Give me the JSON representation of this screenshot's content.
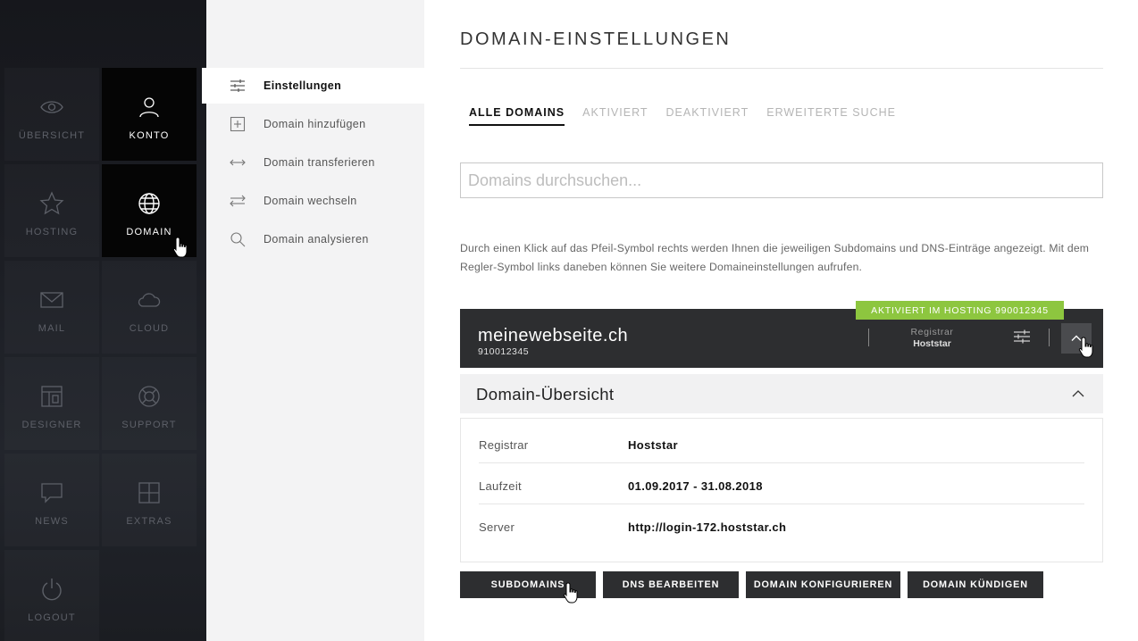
{
  "sidebar": {
    "tiles": [
      {
        "key": "uebersicht",
        "label": "ÜBERSICHT",
        "icon": "eye-icon",
        "active": false
      },
      {
        "key": "konto",
        "label": "KONTO",
        "icon": "user-icon",
        "active": true
      },
      {
        "key": "hosting",
        "label": "HOSTING",
        "icon": "star-icon",
        "active": false
      },
      {
        "key": "domain",
        "label": "DOMAIN",
        "icon": "globe-icon",
        "active": true
      },
      {
        "key": "mail",
        "label": "MAIL",
        "icon": "envelope-icon",
        "active": false
      },
      {
        "key": "cloud",
        "label": "CLOUD",
        "icon": "cloud-icon",
        "active": false
      },
      {
        "key": "designer",
        "label": "DESIGNER",
        "icon": "layout-icon",
        "active": false
      },
      {
        "key": "support",
        "label": "SUPPORT",
        "icon": "lifebuoy-icon",
        "active": false
      },
      {
        "key": "news",
        "label": "NEWS",
        "icon": "speech-bubble-icon",
        "active": false
      },
      {
        "key": "extras",
        "label": "EXTRAS",
        "icon": "plus-box-icon",
        "active": false
      },
      {
        "key": "logout",
        "label": "LOGOUT",
        "icon": "power-icon",
        "active": false
      }
    ]
  },
  "submenu": {
    "items": [
      {
        "label": "Einstellungen",
        "icon": "sliders-icon",
        "active": true
      },
      {
        "label": "Domain hinzufügen",
        "icon": "plus-square-icon",
        "active": false
      },
      {
        "label": "Domain transferieren",
        "icon": "double-arrow-icon",
        "active": false
      },
      {
        "label": "Domain wechseln",
        "icon": "swap-arrows-icon",
        "active": false
      },
      {
        "label": "Domain analysieren",
        "icon": "magnifier-icon",
        "active": false
      }
    ]
  },
  "main": {
    "title": "DOMAIN-EINSTELLUNGEN",
    "tabs": [
      {
        "label": "ALLE DOMAINS",
        "active": true
      },
      {
        "label": "AKTIVIERT",
        "active": false
      },
      {
        "label": "DEAKTIVIERT",
        "active": false
      },
      {
        "label": "ERWEITERTE SUCHE",
        "active": false
      }
    ],
    "search": {
      "placeholder": "Domains durchsuchen...",
      "value": ""
    },
    "description": "Durch einen Klick auf das Pfeil-Symbol rechts werden Ihnen die jeweiligen Subdomains und DNS-Einträge angezeigt. Mit dem Regler-Symbol links daneben können Sie weitere Domaineinstellungen aufrufen.",
    "domain": {
      "badge": "AKTIVIERT IM HOSTING 990012345",
      "name": "meinewebseite.ch",
      "id": "910012345",
      "registrar_label": "Registrar",
      "registrar_value": "Hoststar"
    },
    "overview": {
      "title": "Domain-Übersicht",
      "rows": [
        {
          "key": "Registrar",
          "value": "Hoststar"
        },
        {
          "key": "Laufzeit",
          "value": "01.09.2017 - 31.08.2018"
        },
        {
          "key": "Server",
          "value": "http://login-172.hoststar.ch"
        }
      ]
    },
    "actions": [
      {
        "label": "SUBDOMAINS"
      },
      {
        "label": "DNS BEARBEITEN"
      },
      {
        "label": "DOMAIN KONFIGURIEREN"
      },
      {
        "label": "DOMAIN KÜNDIGEN"
      }
    ]
  },
  "colors": {
    "accent_green": "#8dc63f",
    "dark_bar": "#2d2e30",
    "tile_active": "#050505"
  }
}
